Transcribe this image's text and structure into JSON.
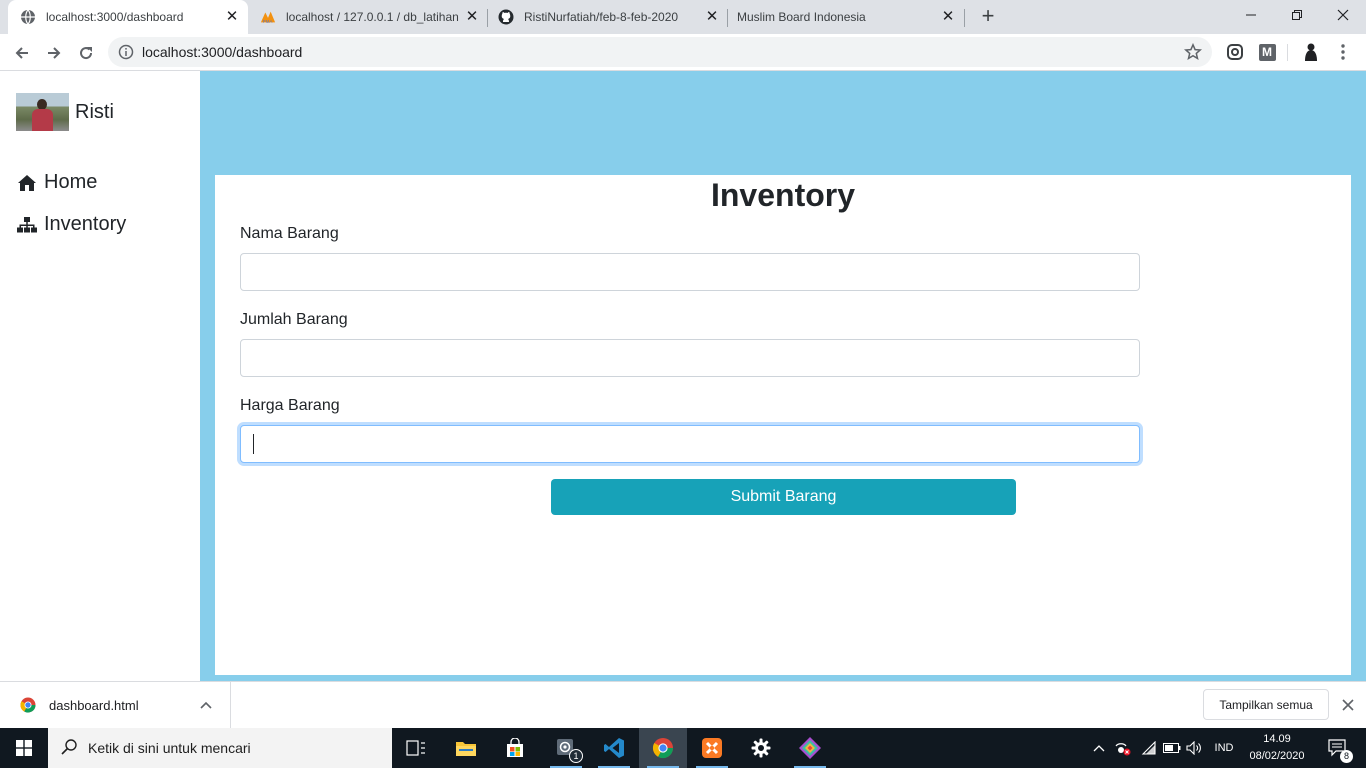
{
  "browser": {
    "tabs": [
      {
        "title": "localhost:3000/dashboard",
        "active": true
      },
      {
        "title": "localhost / 127.0.0.1 / db_latihan",
        "active": false
      },
      {
        "title": "RistiNurfatiah/feb-8-feb-2020",
        "active": false
      },
      {
        "title": "Muslim Board Indonesia",
        "active": false
      }
    ],
    "new_tab": "+",
    "url": "localhost:3000/dashboard",
    "ext_m": "M"
  },
  "sidebar": {
    "profile_name": "Risti",
    "items": [
      {
        "label": "Home",
        "icon": "home-icon"
      },
      {
        "label": "Inventory",
        "icon": "sitemap-icon"
      }
    ]
  },
  "main": {
    "title": "Inventory",
    "fields": [
      {
        "label": "Nama Barang",
        "value": ""
      },
      {
        "label": "Jumlah Barang",
        "value": ""
      },
      {
        "label": "Harga Barang",
        "value": ""
      }
    ],
    "submit_label": "Submit Barang"
  },
  "downloads": {
    "filename": "dashboard.html",
    "show_all": "Tampilkan semua"
  },
  "taskbar": {
    "search_placeholder": "Ketik di sini untuk mencari",
    "badge_count": "1",
    "language": "IND",
    "time": "14.09",
    "date": "08/02/2020",
    "notification_count": "8"
  },
  "colors": {
    "main_bg": "#87ceeb",
    "submit_bg": "#17a2b8"
  }
}
